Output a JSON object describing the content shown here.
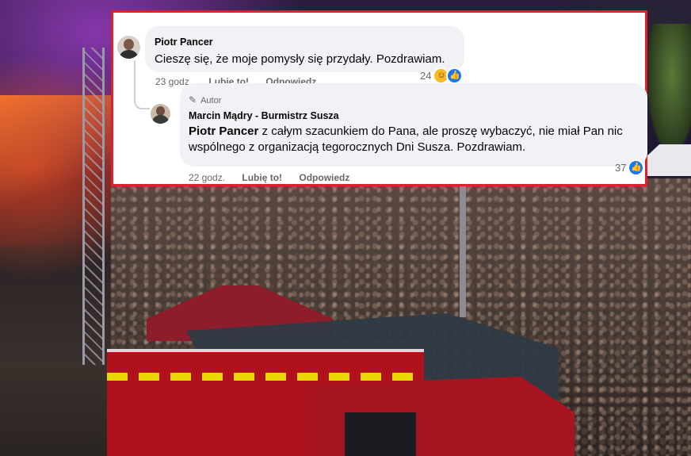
{
  "comment1": {
    "author": "Piotr Pancer",
    "text": "Cieszę się, że moje pomysły się przydały. Pozdrawiam.",
    "time": "23 godz.",
    "like_label": "Lubię to!",
    "reply_label": "Odpowiedz",
    "reaction_count": "24",
    "reaction_icons": [
      "haha-icon",
      "like-icon"
    ]
  },
  "comment2": {
    "badge": "Autor",
    "author": "Marcin Mądry - Burmistrz Susza",
    "mention": "Piotr Pancer",
    "text": " z całym szacunkiem do Pana, ale proszę wybaczyć, nie miał Pan nic wspólnego z organizacją tegorocznych Dni Susza. Pozdrawiam.",
    "time": "22 godz.",
    "like_label": "Lubię to!",
    "reply_label": "Odpowiedz",
    "reaction_count": "37",
    "reaction_icons": [
      "like-icon"
    ]
  },
  "colors": {
    "frame": "#e0202b",
    "bubble": "#f0f2f5",
    "meta_text": "#65676b",
    "like_blue": "#1877f2",
    "haha_yellow": "#f7b928"
  }
}
